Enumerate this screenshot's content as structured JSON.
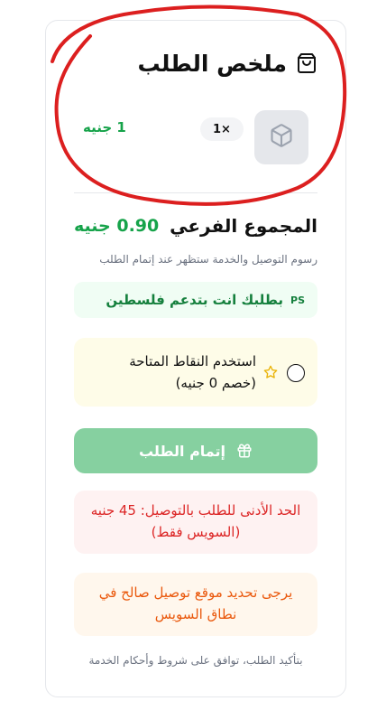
{
  "summary": {
    "title": "ملخص الطلب",
    "icon": "shopping-bag-icon"
  },
  "item": {
    "quantity": "1×",
    "price": "1 جنيه",
    "thumbnail_icon": "package-icon"
  },
  "subtotal": {
    "label": "المجموع الفرعي",
    "value": "0.90 جنيه"
  },
  "fees_note": "رسوم التوصيل والخدمة ستظهر عند إتمام الطلب",
  "palestine": {
    "flag": "PS",
    "text": "بطلبك انت بتدعم فلسطين"
  },
  "points": {
    "line1": "استخدم النقاط المتاحة",
    "line2": "(خصم 0 جنيه)",
    "checked": false
  },
  "checkout": {
    "label": "إتمام الطلب"
  },
  "min_order_warning": {
    "line1": "الحد الأدنى للطلب بالتوصيل: 45 جنيه",
    "line2": "(السويس فقط)"
  },
  "location_warning": {
    "line1": "يرجى تحديد موقع توصيل صالح في",
    "line2": "نطاق السويس"
  },
  "terms": "بتأكيد الطلب، توافق على شروط وأحكام الخدمة",
  "colors": {
    "accent_green": "#16a34a",
    "button_green": "#86d0a0",
    "warning_red": "#dc2626",
    "warning_orange": "#ea580c",
    "annotation_red": "#dc1f1f"
  }
}
